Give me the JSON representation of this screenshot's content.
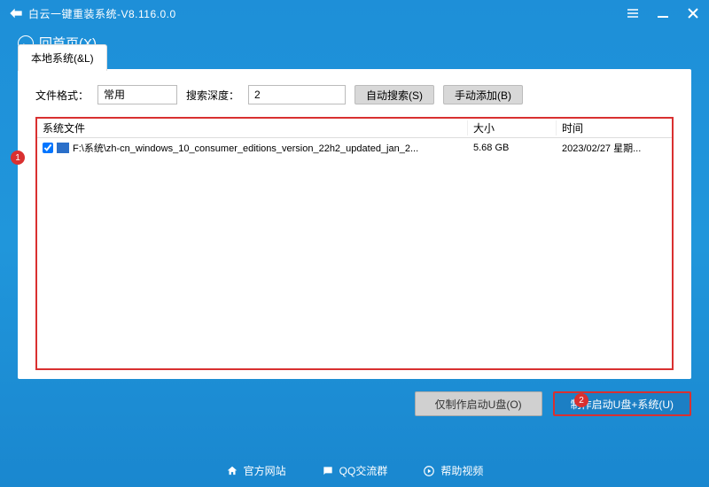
{
  "titlebar": {
    "title": "白云一键重装系统-V8.116.0.0"
  },
  "back": {
    "label": "回首页(X)"
  },
  "tab": {
    "label": "本地系统(&L)"
  },
  "filters": {
    "format_label": "文件格式：",
    "format_value": "常用",
    "depth_label": "搜索深度：",
    "depth_value": "2",
    "auto_search": "自动搜索(S)",
    "manual_add": "手动添加(B)"
  },
  "table": {
    "headers": {
      "file": "系统文件",
      "size": "大小",
      "time": "时间"
    },
    "rows": [
      {
        "checked": true,
        "path": "F:\\系统\\zh-cn_windows_10_consumer_editions_version_22h2_updated_jan_2...",
        "size": "5.68 GB",
        "time": "2023/02/27 星期..."
      }
    ]
  },
  "badges": {
    "one": "1",
    "two": "2"
  },
  "actions": {
    "make_usb": "仅制作启动U盘(O)",
    "make_usb_sys": "制作启动U盘+系统(U)"
  },
  "links": {
    "site": "官方网站",
    "qq": "QQ交流群",
    "help": "帮助视频"
  }
}
